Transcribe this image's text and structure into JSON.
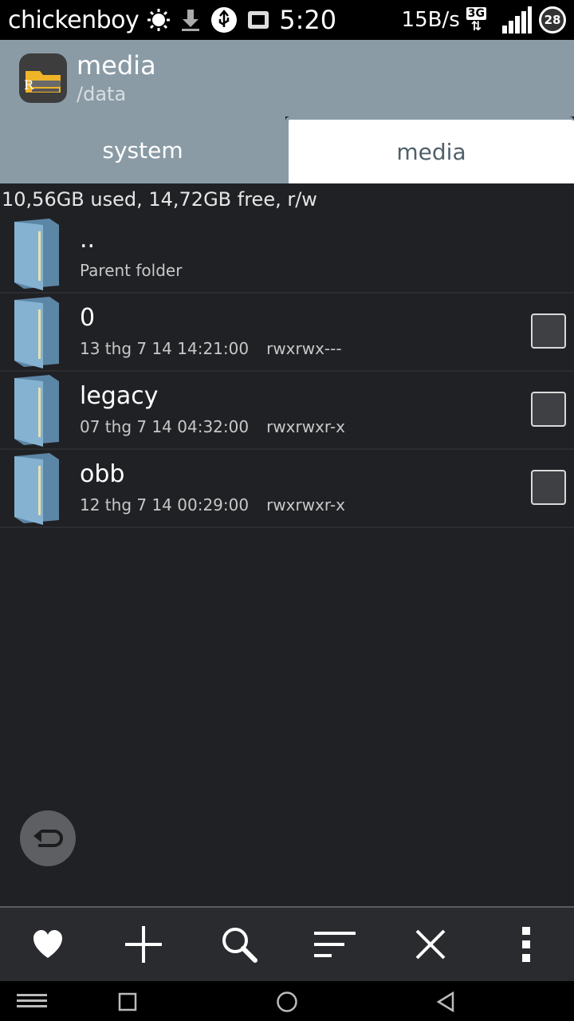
{
  "status_bar": {
    "carrier": "chickenboy",
    "time": "5:20",
    "net_speed": "15B/s",
    "network_type": "3G",
    "battery_level": "28",
    "icons": [
      "brightness-icon",
      "download-icon",
      "usb-icon",
      "sim-icon",
      "signal-icon"
    ]
  },
  "header": {
    "title": "media",
    "subtitle": "/data"
  },
  "tabs": [
    {
      "label": "system",
      "active": false
    },
    {
      "label": "media",
      "active": true
    }
  ],
  "storage_info": "10,56GB used, 14,72GB free, r/w",
  "files": [
    {
      "name": "..",
      "meta": "Parent folder",
      "perm": "",
      "checkbox": false
    },
    {
      "name": "0",
      "meta": "13 thg 7 14 14:21:00",
      "perm": "rwxrwx---",
      "checkbox": true
    },
    {
      "name": "legacy",
      "meta": "07 thg 7 14 04:32:00",
      "perm": "rwxrwxr-x",
      "checkbox": true
    },
    {
      "name": "obb",
      "meta": "12 thg 7 14 00:29:00",
      "perm": "rwxrwxr-x",
      "checkbox": true
    }
  ],
  "toolbar": {
    "icons": [
      "heart-icon",
      "plus-icon",
      "search-icon",
      "sort-icon",
      "close-icon",
      "more-vert-icon"
    ]
  },
  "colors": {
    "header_bg": "#8a9ba5",
    "list_bg": "#202124",
    "folder_blue": "#6f9bbd"
  }
}
